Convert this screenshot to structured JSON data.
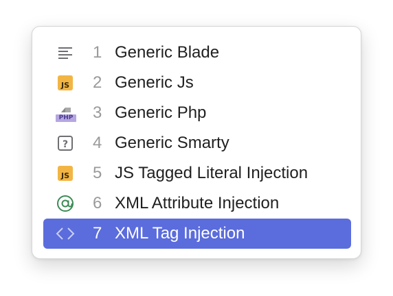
{
  "menu": {
    "items": [
      {
        "number": "1",
        "label": "Generic Blade",
        "icon": "lines-icon",
        "selected": false
      },
      {
        "number": "2",
        "label": "Generic Js",
        "icon": "js-icon",
        "selected": false
      },
      {
        "number": "3",
        "label": "Generic Php",
        "icon": "php-icon",
        "selected": false
      },
      {
        "number": "4",
        "label": "Generic Smarty",
        "icon": "question-icon",
        "selected": false
      },
      {
        "number": "5",
        "label": "JS Tagged Literal Injection",
        "icon": "js-icon",
        "selected": false
      },
      {
        "number": "6",
        "label": "XML Attribute Injection",
        "icon": "at-icon",
        "selected": false
      },
      {
        "number": "7",
        "label": "XML Tag Injection",
        "icon": "code-brackets-icon",
        "selected": true
      }
    ],
    "icon_text": {
      "js": "JS",
      "php": "PHP"
    }
  },
  "colors": {
    "selection": "#5b6cdc",
    "js_badge": "#f2b544",
    "php_badge": "#b6a6e0",
    "at_icon": "#3c8a55"
  }
}
